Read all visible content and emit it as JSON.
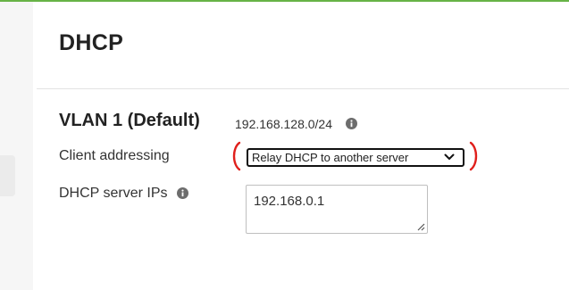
{
  "page": {
    "title": "DHCP"
  },
  "vlan": {
    "title": "VLAN 1 (Default)",
    "subnet": "192.168.128.0/24"
  },
  "client_addressing": {
    "label": "Client addressing",
    "selected": "Relay DHCP to another server"
  },
  "dhcp_server_ips": {
    "label": "DHCP server IPs",
    "value": "192.168.0.1"
  },
  "colors": {
    "accent_top": "#67b346",
    "annotation": "#e0201c"
  },
  "icons": [
    "info-icon",
    "chevron-down-icon",
    "resize-grip-icon"
  ]
}
